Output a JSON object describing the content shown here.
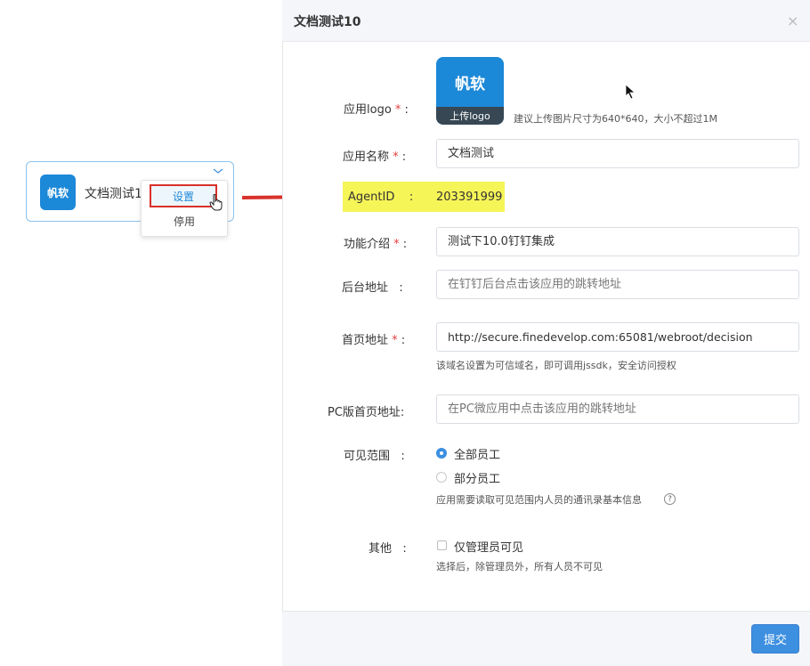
{
  "card": {
    "logo_text": "帆软",
    "name": "文档测试1",
    "menu": {
      "settings": "设置",
      "disable": "停用"
    }
  },
  "dialog": {
    "title": "文档测试10",
    "close": "×",
    "submit": "提交"
  },
  "form": {
    "logo": {
      "label": "应用logo",
      "logo_text": "帆软",
      "upload": "上传logo",
      "hint": "建议上传图片尺寸为640*640，大小不超过1M"
    },
    "name": {
      "label": "应用名称",
      "value": "文档测试"
    },
    "agent": {
      "label": "AgentID",
      "colon": ":",
      "value": "203391999"
    },
    "intro": {
      "label": "功能介绍",
      "value": "测试下10.0钉钉集成"
    },
    "backend": {
      "label": "后台地址",
      "colon": ":",
      "placeholder": "在钉钉后台点击该应用的跳转地址"
    },
    "homepage": {
      "label": "首页地址",
      "value": "http://secure.finedevelop.com:65081/webroot/decision",
      "hint": "该域名设置为可信域名，即可调用jssdk，安全访问授权"
    },
    "pc_homepage": {
      "label": "PC版首页地址:",
      "placeholder": "在PC微应用中点击该应用的跳转地址"
    },
    "visibility": {
      "label": "可见范围",
      "colon": ":",
      "options": [
        "全部员工",
        "部分员工"
      ],
      "selected": "全部员工",
      "hint": "应用需要读取可见范围内人员的通讯录基本信息",
      "help": "?"
    },
    "other": {
      "label": "其他",
      "colon": ":",
      "checkbox": "仅管理员可见",
      "checked": false,
      "hint": "选择后，除管理员外，所有人员不可见"
    },
    "required_mark": "*"
  },
  "colors": {
    "primary": "#3d8fe0",
    "brand": "#1c88d8",
    "highlight": "#f6f558",
    "arrow": "#d9312b"
  }
}
